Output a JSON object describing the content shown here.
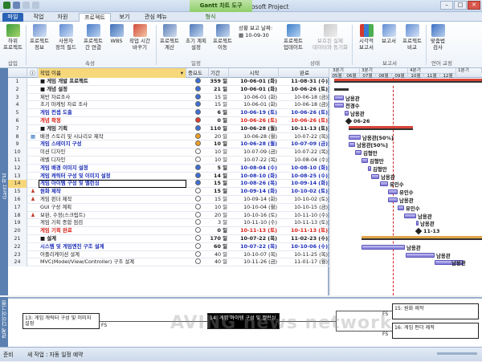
{
  "window": {
    "title": "게임 개발.mpp - Microsoft Project",
    "context_tab": "Gantt 차트 도구"
  },
  "tabs": [
    "파일",
    "작업",
    "자원",
    "프로젝트",
    "보기",
    "관심 메뉴",
    "형식"
  ],
  "ribbon": {
    "buttons": [
      {
        "label": "하위\n프로젝트",
        "icon": "subproject-icon"
      },
      {
        "label": "프로젝트\n정보",
        "icon": "project-info-icon"
      },
      {
        "label": "사용자\n정의 필드",
        "icon": "custom-fields-icon"
      },
      {
        "label": "프로젝트\n간 연결",
        "icon": "links-between-projects-icon"
      },
      {
        "label": "WBS",
        "icon": "wbs-icon"
      },
      {
        "label": "작업 시간\n바꾸기",
        "icon": "change-working-time-icon"
      },
      {
        "label": "프로젝트\n계산",
        "icon": "calculate-project-icon"
      },
      {
        "label": "초기 계획\n설정",
        "icon": "set-baseline-icon"
      },
      {
        "label": "프로젝트\n이동",
        "icon": "move-project-icon"
      },
      {
        "label": "프로젝트\n업데이트",
        "icon": "update-project-icon"
      },
      {
        "label": "보호된 실제\n데이터와 동기화",
        "icon": "sync-icon"
      },
      {
        "label": "시각적\n보고서",
        "icon": "visual-reports-icon"
      },
      {
        "label": "보고서",
        "icon": "reports-icon"
      },
      {
        "label": "프로젝트\n비교",
        "icon": "compare-projects-icon"
      },
      {
        "label": "맞춤법\n검사",
        "icon": "spelling-icon"
      }
    ],
    "groups": [
      "삽입",
      "속성",
      "일정",
      "상태",
      "보고서",
      "언어 교정"
    ],
    "status_date_label": "상황 보고 날짜:",
    "status_date": "10-09-30"
  },
  "side_labels": {
    "top": "Gantt 차트",
    "bottom": "관계 다이어그램"
  },
  "columns": {
    "info": "ⓘ",
    "name": "작업 이름",
    "mode": "중요도",
    "duration": "기간",
    "start": "시작",
    "finish": "완료"
  },
  "rows": [
    {
      "id": "1",
      "name": "■ 게임 개발 프로젝트",
      "dur": "359 일",
      "start": "10-06-01 (화)",
      "finish": "11-08-31 (수)",
      "style": "b",
      "dot": "#3b6fd6"
    },
    {
      "id": "2",
      "name": "  ■ 개념 설정",
      "dur": "21 일",
      "start": "10-06-01 (화)",
      "finish": "10-06-26 (토)",
      "style": "b",
      "dot": "#3b6fd6"
    },
    {
      "id": "3",
      "name": "     제반 자료조사",
      "dur": "15 일",
      "start": "10-06-01 (화)",
      "finish": "10-06-18 (금)",
      "style": "",
      "dot": "#3b6fd6"
    },
    {
      "id": "4",
      "name": "     초기 마케팅 자료 조사",
      "dur": "15 일",
      "start": "10-06-01 (화)",
      "finish": "10-06-18 (금)",
      "style": "",
      "dot": "#3b6fd6"
    },
    {
      "id": "5",
      "name": "     게임 컨셉 도출",
      "dur": "6 일",
      "start": "10-06-19 (토)",
      "finish": "10-06-26 (토)",
      "style": "b blue",
      "dot": "#3b6fd6"
    },
    {
      "id": "6",
      "name": "     개념 확정",
      "dur": "0 일",
      "start": "10-06-26 (토)",
      "finish": "10-06-26 (토)",
      "style": "b red",
      "dot": "#e13a2e"
    },
    {
      "id": "7",
      "name": "  ■ 게임 기획",
      "dur": "110 일",
      "start": "10-06-28 (월)",
      "finish": "10-11-13 (토)",
      "style": "b",
      "dot": "#3b6fd6"
    },
    {
      "id": "8",
      "name": "     배경 스토리 및 시나리오 제작",
      "dur": "20 일",
      "start": "10-06-28 (월)",
      "finish": "10-07-22 (목)",
      "style": "",
      "dot": "#f0a020",
      "ind": "calendar"
    },
    {
      "id": "9",
      "name": "     게임 스테이지 구성",
      "dur": "10 일",
      "start": "10-06-28 (월)",
      "finish": "10-07-09 (금)",
      "style": "b blue",
      "dot": "#f0a020"
    },
    {
      "id": "10",
      "name": "     미션 디자인",
      "dur": "10 일",
      "start": "10-07-09 (금)",
      "finish": "10-07-22 (목)",
      "style": "",
      "dot": "#ffffff"
    },
    {
      "id": "11",
      "name": "     레벨 디자인",
      "dur": "10 일",
      "start": "10-07-22 (목)",
      "finish": "10-08-04 (수)",
      "style": "",
      "dot": "#ffffff"
    },
    {
      "id": "12",
      "name": "     게임 배경 이미지 설정",
      "dur": "5 일",
      "start": "10-08-04 (수)",
      "finish": "10-08-10 (화)",
      "style": "b blue",
      "dot": "#3b6fd6"
    },
    {
      "id": "13",
      "name": "     게임 캐릭터 구성 및 이미지 설정",
      "dur": "14 일",
      "start": "10-08-10 (화)",
      "finish": "10-08-25 (수)",
      "style": "b blue",
      "dot": "#3b6fd6"
    },
    {
      "id": "14",
      "name": "     게임 아이템 구성 및 밸런싱",
      "dur": "15 일",
      "start": "10-08-26 (목)",
      "finish": "10-09-14 (화)",
      "style": "b blue",
      "dot": "#3b6fd6",
      "hl": true
    },
    {
      "id": "15",
      "name": "     원화 제작",
      "dur": "15 일",
      "start": "10-09-14 (화)",
      "finish": "10-10-02 (토)",
      "style": "b blue",
      "dot": "#ffffff",
      "ind": "person"
    },
    {
      "id": "16",
      "name": "     게임 펀더 제작",
      "dur": "15 일",
      "start": "10-09-14 (화)",
      "finish": "10-10-02 (토)",
      "style": "",
      "dot": "#ffffff",
      "ind": "person"
    },
    {
      "id": "17",
      "name": "     GUI 구성 계획",
      "dur": "10 일",
      "start": "10-10-04 (월)",
      "finish": "10-10-15 (금)",
      "style": "",
      "dot": "#ffffff"
    },
    {
      "id": "18",
      "name": "     보완, 수정(스크립트)",
      "dur": "20 일",
      "start": "10-10-16 (토)",
      "finish": "10-11-10 (수)",
      "style": "",
      "dot": "#ffffff",
      "ind": "person"
    },
    {
      "id": "19",
      "name": "     게임 기획 종합 점검",
      "dur": "3 일",
      "start": "10-11-10 (수)",
      "finish": "10-11-13 (토)",
      "style": "",
      "dot": "#ffffff"
    },
    {
      "id": "20",
      "name": "     게임 기획 완료",
      "dur": "0 일",
      "start": "10-11-13 (토)",
      "finish": "10-11-13 (토)",
      "style": "b red",
      "dot": "#ffffff"
    },
    {
      "id": "21",
      "name": "  ■ 설계",
      "dur": "170 일",
      "start": "10-07-22 (목)",
      "finish": "11-02-23 (수)",
      "style": "b",
      "dot": "#ffffff"
    },
    {
      "id": "22",
      "name": "     시스템 및 게임엔진 구조 설계",
      "dur": "60 일",
      "start": "10-07-22 (목)",
      "finish": "10-10-06 (수)",
      "style": "b blue",
      "dot": "#ffffff"
    },
    {
      "id": "23",
      "name": "     어플리케이션 설계",
      "dur": "40 일",
      "start": "10-10-07 (목)",
      "finish": "10-11-25 (목)",
      "style": "",
      "dot": "#ffffff"
    },
    {
      "id": "24",
      "name": "     MVC(Model/View/Controller) 구조 설계",
      "dur": "40 일",
      "start": "10-11-26 (금)",
      "finish": "11-01-17 (월)",
      "style": "",
      "dot": "#ffffff"
    }
  ],
  "gantt": {
    "quarters": [
      "3분기",
      "3분기",
      "4분기",
      "1분기"
    ],
    "months": [
      "05월",
      "06월",
      "07월",
      "08월",
      "09월",
      "10월",
      "11월",
      "12월"
    ],
    "today": "10-09-30",
    "labels": [
      {
        "row": 2,
        "text": "남용관"
      },
      {
        "row": 3,
        "text": "전경수"
      },
      {
        "row": 4,
        "text": "남용관"
      },
      {
        "row": 5,
        "text": "06-26"
      },
      {
        "row": 7,
        "text": "남용관[50%]"
      },
      {
        "row": 8,
        "text": "남용관[50%]"
      },
      {
        "row": 9,
        "text": "김형만"
      },
      {
        "row": 10,
        "text": "김형만"
      },
      {
        "row": 11,
        "text": "김형만"
      },
      {
        "row": 12,
        "text": "남용관"
      },
      {
        "row": 13,
        "text": "유인수"
      },
      {
        "row": 14,
        "text": "유인수"
      },
      {
        "row": 15,
        "text": "남용관"
      },
      {
        "row": 16,
        "text": "유인수"
      },
      {
        "row": 17,
        "text": "남용관"
      },
      {
        "row": 18,
        "text": "남용관"
      },
      {
        "row": 19,
        "text": "11-13"
      },
      {
        "row": 21,
        "text": "남용관"
      },
      {
        "row": 22,
        "text": "남용관"
      },
      {
        "row": 23,
        "text": "남용관"
      }
    ]
  },
  "network": {
    "boxes": [
      {
        "text": "13: 게임 캐릭터 구성 및 이미지 설정"
      },
      {
        "text": "14: 게임 아이템 구성 및 밸런싱"
      },
      {
        "text": "15: 원화 제작"
      },
      {
        "text": "16: 게임 펀더 제작"
      }
    ],
    "link_label": "FS"
  },
  "watermark": "AVING news network",
  "status": {
    "ready": "준비",
    "new_task": "새 작업 : 자동 일정 예약"
  }
}
